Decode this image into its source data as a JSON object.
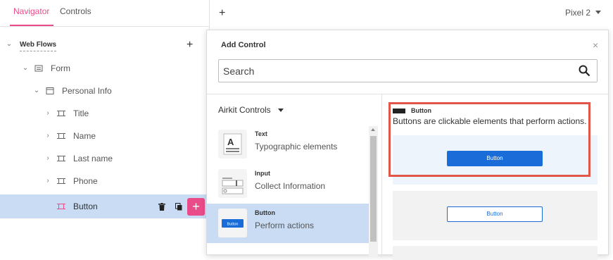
{
  "nav": {
    "tabs": [
      "Navigator",
      "Controls"
    ],
    "active_tab": 0,
    "tree": [
      {
        "label": "Web Flows",
        "level": 0
      },
      {
        "label": "Form",
        "level": 1
      },
      {
        "label": "Personal Info",
        "level": 2
      },
      {
        "label": "Title",
        "level": 3
      },
      {
        "label": "Name",
        "level": 3
      },
      {
        "label": "Last name",
        "level": 3
      },
      {
        "label": "Phone",
        "level": 3
      },
      {
        "label": "Button",
        "level": 3,
        "selected": true
      }
    ],
    "add_symbol": "+"
  },
  "topbar": {
    "add_symbol": "+",
    "device": "Pixel 2"
  },
  "modal": {
    "title": "Add Control",
    "close_symbol": "×",
    "search_placeholder": "Search",
    "category": "Airkit Controls",
    "controls": [
      {
        "name": "Text",
        "desc": "Typographic elements",
        "thumb_glyph": "A"
      },
      {
        "name": "Input",
        "desc": "Collect Information",
        "thumb_glyph": "I"
      },
      {
        "name": "Button",
        "desc": "Perform actions",
        "thumb_glyph": "Button",
        "selected": true
      }
    ],
    "preview": {
      "name": "Button",
      "desc": "Buttons are clickable elements that perform actions.",
      "variants": [
        {
          "label": "Button",
          "style": "primary"
        },
        {
          "label": "Button",
          "style": "outline"
        }
      ]
    }
  },
  "colors": {
    "accent_pink": "#ea4c89",
    "selection_blue": "#c9dcf4",
    "button_blue": "#1a6dd9",
    "highlight_red": "#e0574a"
  }
}
